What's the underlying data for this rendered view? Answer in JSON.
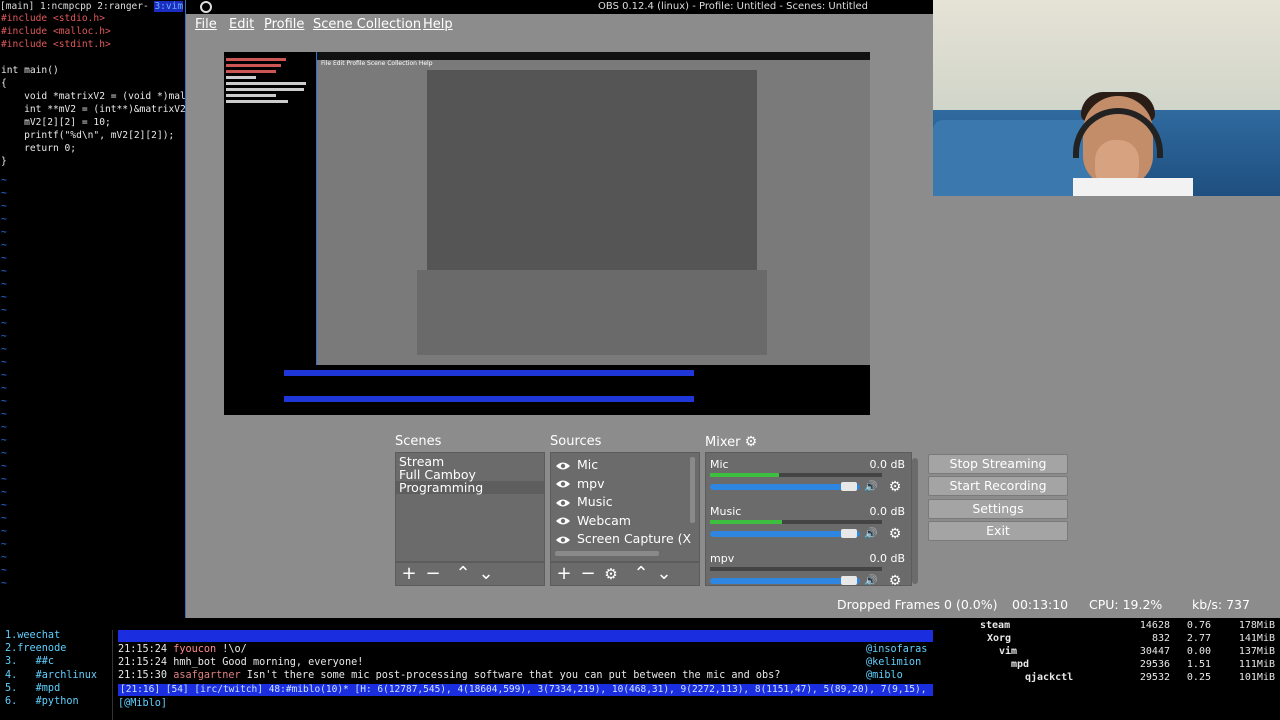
{
  "tmux": {
    "left": "[main] 1:ncmpcpp  2:ranger- ",
    "active": "3:vim"
  },
  "vim": {
    "lines": [
      {
        "t": "#include <stdio.h>",
        "c": "inc"
      },
      {
        "t": "#include <malloc.h>",
        "c": "inc"
      },
      {
        "t": "#include <stdint.h>",
        "c": "inc"
      },
      {
        "t": "",
        "c": ""
      },
      {
        "t": "int main()",
        "c": ""
      },
      {
        "t": "{",
        "c": ""
      },
      {
        "t": "    void *matrixV2 = (void *)mall",
        "c": ""
      },
      {
        "t": "    int **mV2 = (int**)&matrixV2;",
        "c": ""
      },
      {
        "t": "    mV2[2][2] = 10;",
        "c": ""
      },
      {
        "t": "    printf(\"%d\\n\", mV2[2][2]);",
        "c": ""
      },
      {
        "t": "    return 0;",
        "c": ""
      },
      {
        "t": "}",
        "c": ""
      }
    ],
    "tilde": "~"
  },
  "obs": {
    "title": "OBS 0.12.4 (linux) - Profile: Untitled - Scenes: Untitled",
    "menu": [
      "File",
      "Edit",
      "Profile",
      "Scene Collection",
      "Help"
    ],
    "scenes_label": "Scenes",
    "sources_label": "Sources",
    "mixer_label": "Mixer",
    "scenes": [
      "Stream",
      "Full Camboy",
      "Programming"
    ],
    "selected_scene": 2,
    "sources": [
      "Mic",
      "mpv",
      "Music",
      "Webcam",
      "Screen Capture (X"
    ],
    "mixer": [
      {
        "name": "Mic",
        "db": "0.0 dB",
        "level": 0.4
      },
      {
        "name": "Music",
        "db": "0.0 dB",
        "level": 0.42
      },
      {
        "name": "mpv",
        "db": "0.0 dB",
        "level": 0.0
      }
    ],
    "controls": [
      "Stop Streaming",
      "Start Recording",
      "Settings",
      "Exit"
    ],
    "status": {
      "dropped": "Dropped Frames 0 (0.0%)",
      "time": "00:13:10",
      "cpu": "CPU: 19.2%",
      "kbs": "kb/s: 737"
    },
    "tb_plus": "+",
    "tb_minus": "−",
    "tb_up": "⌃",
    "tb_down": "⌄",
    "tb_gear": "⚙",
    "gear": "⚙",
    "speaker": "🔊",
    "nested_menu": "File  Edit  Profile  Scene Collection  Help"
  },
  "weechat": {
    "buffers": [
      "1.weechat",
      "2.freenode",
      "3.   ##c",
      "4.   #archlinux",
      "5.   #mpd",
      "6.   #python"
    ],
    "lines": [
      {
        "time": "21:15:24 ",
        "nick": "fyoucon",
        "nickClass": "nick1",
        "msg": " !\\o/"
      },
      {
        "time": "21:15:24 ",
        "nick": "hmh_bot",
        "nickClass": "nick2",
        "msg": " Good morning, everyone!"
      },
      {
        "time": "21:15:30 ",
        "nick": "asafgartner",
        "nickClass": "nick3",
        "msg": " Isn't there some mic post-processing software that you can put between the mic and obs?"
      }
    ],
    "status": "[21:16] [54] [irc/twitch] 48:#miblo(10)* [H: 6(12787,545), 4(18604,599), 3(7334,219), 10(468,31), 9(2272,113), 8(1151,47), 5(89,20), 7(9,15), 1",
    "nicks": [
      "@insofaras",
      "@kelimion",
      "@miblo"
    ],
    "input": "[@Miblo]"
  },
  "htop": [
    {
      "name": "steam",
      "pid": "14628",
      "cpu": "0.76",
      "mem": "178MiB"
    },
    {
      "name": "Xorg",
      "pid": "832",
      "cpu": "2.77",
      "mem": "141MiB"
    },
    {
      "name": "vim",
      "pid": "30447",
      "cpu": "0.00",
      "mem": "137MiB"
    },
    {
      "name": "mpd",
      "pid": "29536",
      "cpu": "1.51",
      "mem": "111MiB"
    },
    {
      "name": "qjackctl",
      "pid": "29532",
      "cpu": "0.25",
      "mem": "101MiB"
    }
  ],
  "colors": {
    "accent": "#2f86e0",
    "obs_bg": "#8c8c8c",
    "weechat_bar": "#1a2ee0"
  }
}
